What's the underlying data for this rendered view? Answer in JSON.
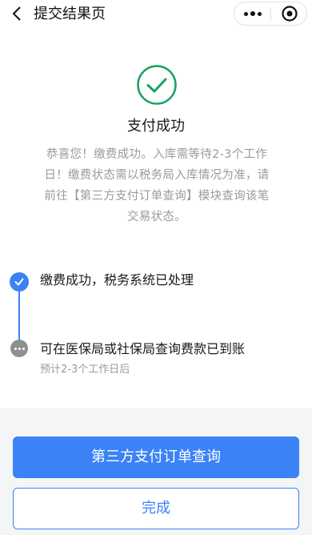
{
  "header": {
    "title": "提交结果页"
  },
  "result": {
    "title": "支付成功",
    "description": "恭喜您！缴费成功。入库需等待2-3个工作日！缴费状态需以税务局入库情况为准，请前往【第三方支付订单查询】模块查询该笔交易状态。"
  },
  "timeline": {
    "steps": [
      {
        "label": "缴费成功，税务系统已处理",
        "status": "done"
      },
      {
        "label": "可在医保局或社保局查询费款已到账",
        "sub": "预计2-3个工作日后",
        "status": "pending"
      }
    ]
  },
  "actions": {
    "primary_label": "第三方支付订单查询",
    "secondary_label": "完成"
  },
  "colors": {
    "accent": "#3b82f6",
    "success": "#1aa163",
    "pending": "#8f8f8f"
  }
}
